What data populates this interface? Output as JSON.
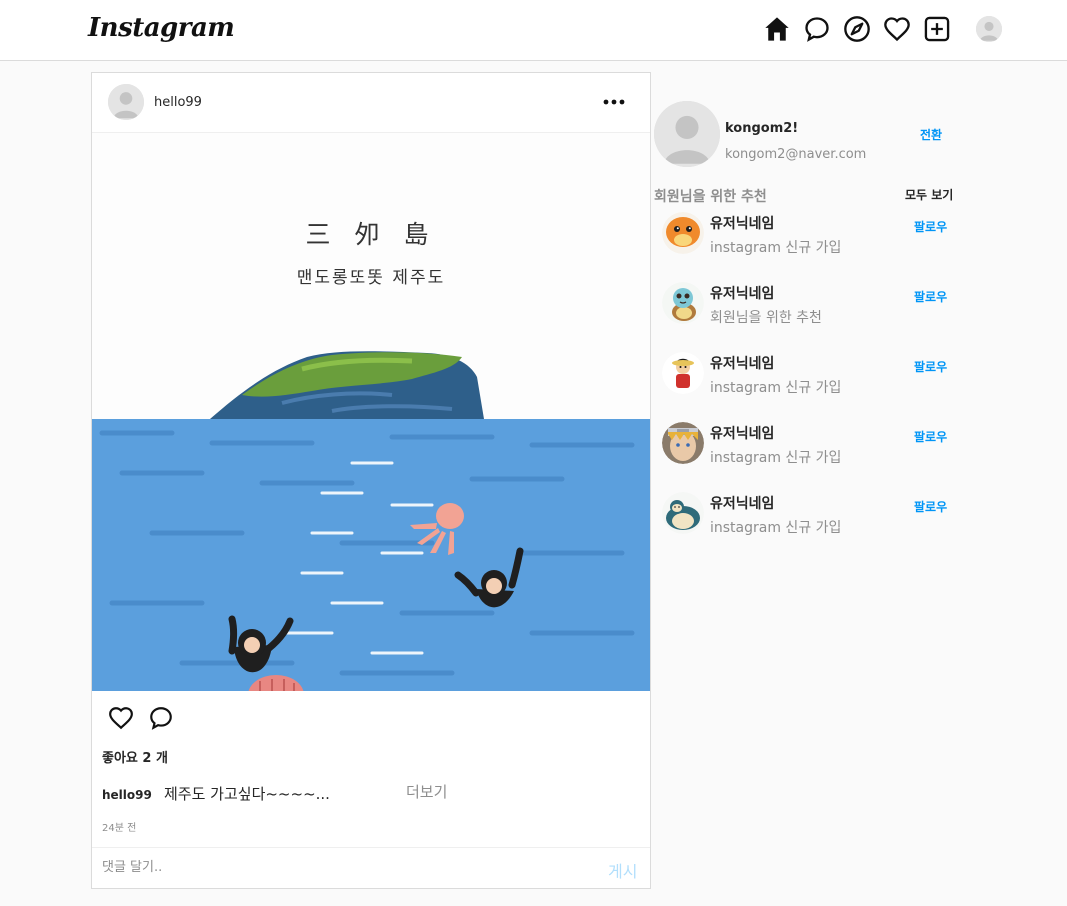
{
  "nav": {
    "logo": "Instagram",
    "icons": [
      "home-icon",
      "direct-message-icon",
      "explore-compass-icon",
      "activity-heart-icon",
      "new-post-icon",
      "profile-avatar"
    ]
  },
  "post": {
    "username": "hello99",
    "image": {
      "title_line1": "三 夘 島",
      "title_line2": "맨도롱또똣 제주도"
    },
    "likes_text": "좋아요 2 개",
    "caption_user": "hello99",
    "caption_text": "제주도 가고싶다~~~~...",
    "more_label": "더보기",
    "time": "24분 전",
    "comment_placeholder": "댓글 달기..",
    "post_button": "게시"
  },
  "sidebar": {
    "user": {
      "name": "kongom2!",
      "email": "kongom2@naver.com",
      "switch_label": "전환"
    },
    "recommend_title": "회원님을 위한 추천",
    "see_all_label": "모두 보기",
    "items": [
      {
        "name": "유저닉네임",
        "sub": "instagram 신규 가입",
        "follow": "팔로우",
        "avatar": "charmander"
      },
      {
        "name": "유저닉네임",
        "sub": "회원님을 위한 추천",
        "follow": "팔로우",
        "avatar": "squirtle"
      },
      {
        "name": "유저닉네임",
        "sub": "instagram 신규 가입",
        "follow": "팔로우",
        "avatar": "luffy"
      },
      {
        "name": "유저닉네임",
        "sub": "instagram 신규 가입",
        "follow": "팔로우",
        "avatar": "naruto"
      },
      {
        "name": "유저닉네임",
        "sub": "instagram 신규 가입",
        "follow": "팔로우",
        "avatar": "snorlax"
      }
    ]
  },
  "colors": {
    "link_blue": "#0095f6",
    "post_button_disabled": "#b2dffc",
    "border": "#dbdbdb",
    "background": "#fafafa"
  }
}
